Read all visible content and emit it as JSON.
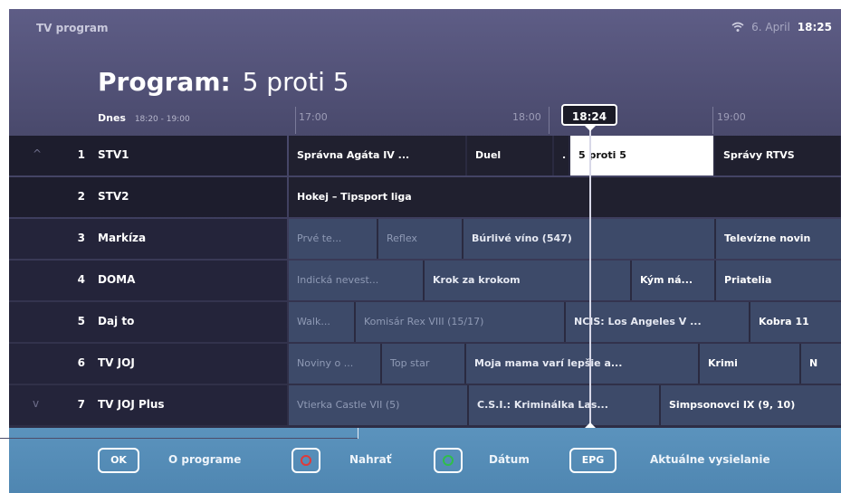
{
  "status_bar": {
    "app_title": "TV program",
    "wifi_icon": "wifi-icon",
    "date": "6. April",
    "time": "18:25"
  },
  "header": {
    "label": "Program:",
    "program": "5 proti 5",
    "today": "Dnes",
    "today_range": "18:20 - 19:00"
  },
  "timeline": {
    "ticks": [
      "17:00",
      "18:00",
      "19:00"
    ],
    "now": "18:24"
  },
  "channels": [
    {
      "arrow": "^",
      "number": "1",
      "name": "STV1",
      "programs": [
        "Správna Agáta IV ...",
        "Duel",
        ".",
        "5 proti 5",
        "Správy RTVS"
      ]
    },
    {
      "arrow": "",
      "number": "2",
      "name": "STV2",
      "programs": [
        "Hokej – Tipsport liga"
      ]
    },
    {
      "arrow": "",
      "number": "3",
      "name": "Markíza",
      "programs": [
        "Prvé te...",
        "Reflex",
        "Búrlivé víno (547)",
        "Televízne novin"
      ]
    },
    {
      "arrow": "",
      "number": "4",
      "name": "DOMA",
      "programs": [
        "Indická nevest...",
        "Krok za krokom",
        "Kým ná...",
        "Priatelia"
      ]
    },
    {
      "arrow": "",
      "number": "5",
      "name": "Daj to",
      "programs": [
        "Walk...",
        "Komisár Rex VIII (15/17)",
        "NCIS: Los Angeles V ...",
        "Kobra 11"
      ]
    },
    {
      "arrow": "",
      "number": "6",
      "name": "TV JOJ",
      "programs": [
        "Noviny o ...",
        "Top star",
        "Moja mama varí lepšie a...",
        "Krimi",
        "N"
      ]
    },
    {
      "arrow": "v",
      "number": "7",
      "name": "TV JOJ Plus",
      "programs": [
        "Vtierka Castle VII (5)",
        "C.S.I.: Kriminálka Las...",
        "Simpsonovci IX (9, 10)"
      ]
    }
  ],
  "footer": {
    "ok_key": "OK",
    "ok_label": "O programe",
    "record_label": "Nahrať",
    "date_label": "Dátum",
    "epg_key": "EPG",
    "epg_label": "Aktuálne vysielanie",
    "record_color": "#e03a3a",
    "date_color": "#2fbf4a"
  }
}
